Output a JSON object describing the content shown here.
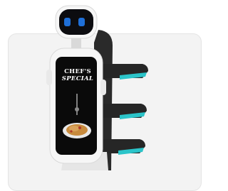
{
  "product": {
    "name": "delivery-robot",
    "screen_headline_line1": "CHEF'S",
    "screen_headline_line2": "SPECIAL"
  },
  "colors": {
    "card_bg": "#f3f3f3",
    "robot_body": "#f6f6f6",
    "face_screen": "#0c0c10",
    "eyes": "#1f6fd8",
    "tray_accent": "#2bc4c9",
    "tray_dark": "#262626"
  },
  "icons": [
    "robot-head-icon",
    "eyes-icon",
    "pasta-dish-icon"
  ]
}
